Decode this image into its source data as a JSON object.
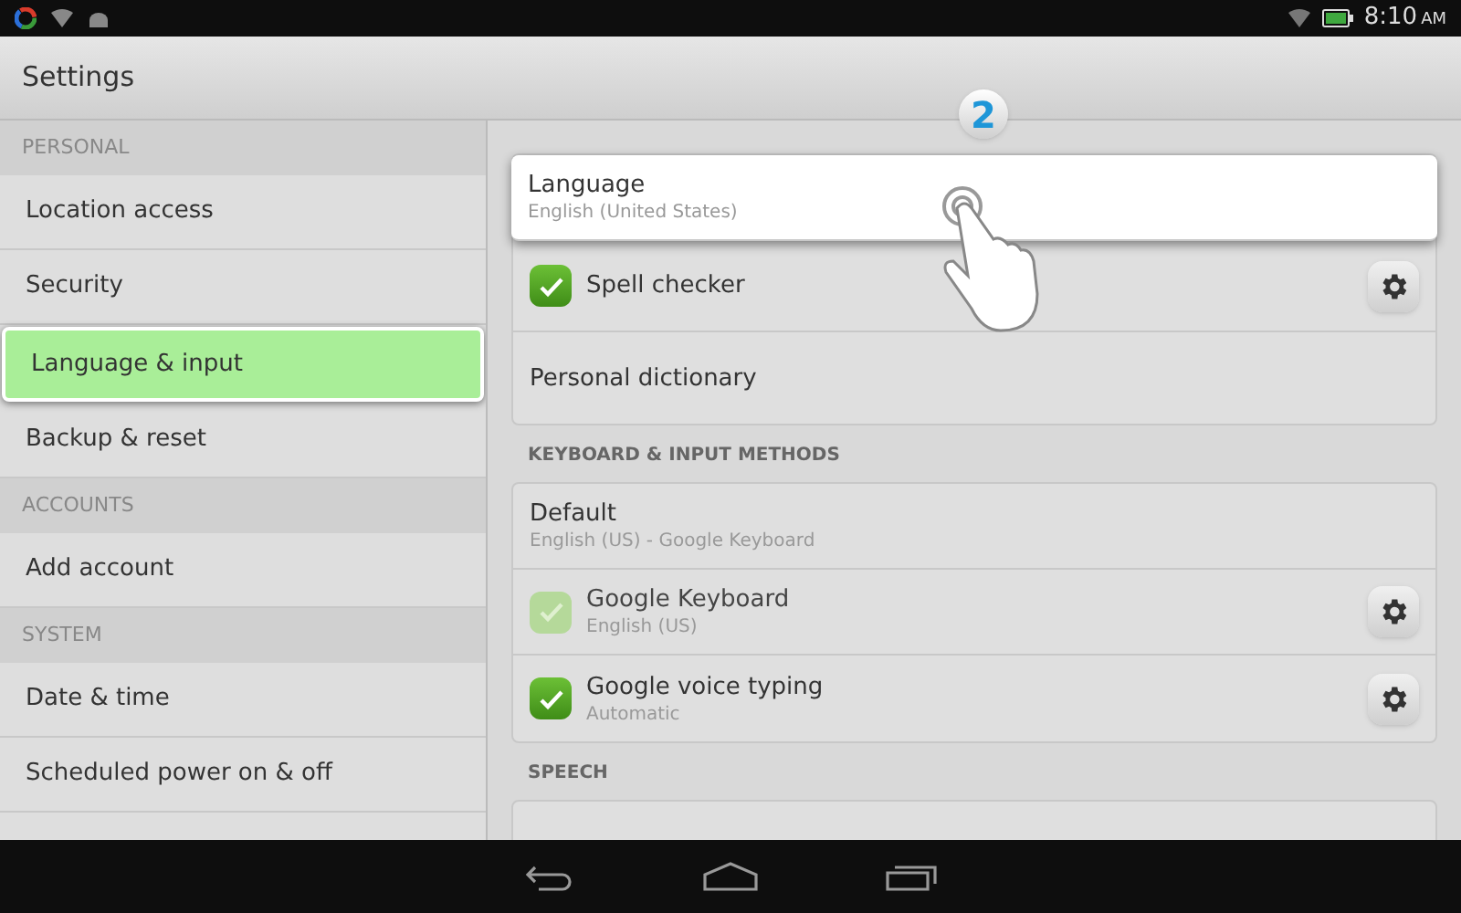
{
  "status_bar": {
    "time": "8:10",
    "ampm": "AM"
  },
  "title": "Settings",
  "sidebar": [
    {
      "kind": "header",
      "label": "PERSONAL"
    },
    {
      "kind": "item",
      "label": "Location access",
      "selected": false
    },
    {
      "kind": "item",
      "label": "Security",
      "selected": false
    },
    {
      "kind": "item",
      "label": "Language & input",
      "selected": true
    },
    {
      "kind": "item",
      "label": "Backup & reset",
      "selected": false
    },
    {
      "kind": "header",
      "label": "ACCOUNTS"
    },
    {
      "kind": "item",
      "label": "Add account",
      "selected": false
    },
    {
      "kind": "header",
      "label": "SYSTEM"
    },
    {
      "kind": "item",
      "label": "Date & time",
      "selected": false
    },
    {
      "kind": "item",
      "label": "Scheduled power on & off",
      "selected": false
    }
  ],
  "step_badge": "2",
  "sections": [
    {
      "rows": [
        {
          "kind": "plain",
          "title": "Language",
          "subtitle": "English (United States)",
          "pressed": true
        },
        {
          "kind": "checkbox",
          "title": "Spell checker",
          "checked": true,
          "disabled": false
        },
        {
          "kind": "plain",
          "title": "Personal dictionary",
          "pressed": false
        }
      ]
    },
    {
      "heading": "KEYBOARD & INPUT METHODS",
      "rows": [
        {
          "kind": "plain",
          "title": "Default",
          "subtitle": "English (US) - Google Keyboard",
          "pressed": false
        },
        {
          "kind": "checkbox",
          "title": "Google Keyboard",
          "subtitle": "English (US)",
          "checked": true,
          "disabled": true
        },
        {
          "kind": "checkbox",
          "title": "Google voice typing",
          "subtitle": "Automatic",
          "checked": true,
          "disabled": false
        }
      ]
    },
    {
      "heading": "SPEECH"
    }
  ]
}
